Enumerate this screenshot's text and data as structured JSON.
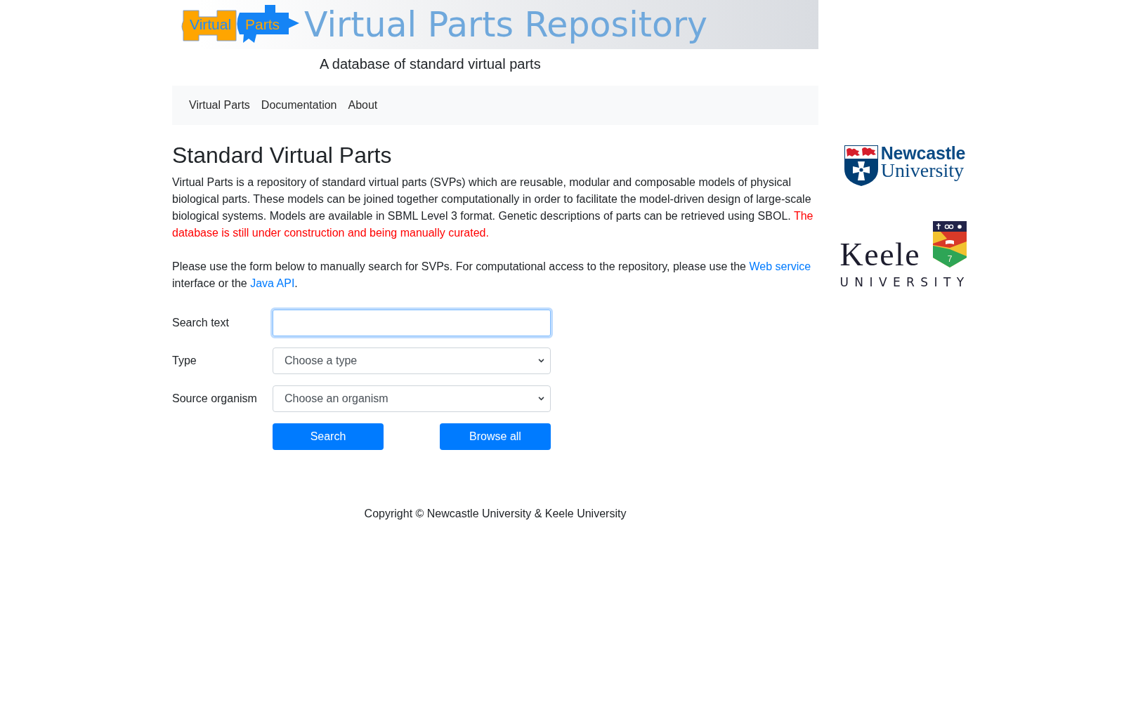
{
  "banner": {
    "logo_words": [
      "Virtual",
      "Parts"
    ],
    "title": "Virtual Parts Repository",
    "subtitle": "A database of standard virtual parts"
  },
  "nav": {
    "items": [
      {
        "label": "Virtual Parts"
      },
      {
        "label": "Documentation"
      },
      {
        "label": "About"
      }
    ]
  },
  "main": {
    "heading": "Standard Virtual Parts",
    "paragraphs": [
      [
        {
          "kind": "text",
          "text": "Virtual Parts is a repository of standard virtual parts (SVPs) which are reusable, modular and composable models of physical biological parts. These models can be joined together computationally in order to facilitate the model-driven design of large-scale biological systems. Models are available in SBML Level 3 format. Genetic descriptions of parts can be retrieved using SBOL. "
        },
        {
          "kind": "warning",
          "text": "The database is still under construction and being manually curated."
        }
      ],
      [
        {
          "kind": "text",
          "text": "Please use the form below to manually search for SVPs. For computational access to the repository, please use the "
        },
        {
          "kind": "link",
          "text": "Web service"
        },
        {
          "kind": "text",
          "text": " interface or the "
        },
        {
          "kind": "link",
          "text": "Java API"
        },
        {
          "kind": "text",
          "text": "."
        }
      ]
    ]
  },
  "form": {
    "fields": [
      {
        "label": "Search text",
        "kind": "input",
        "focused": true
      },
      {
        "label": "Type",
        "kind": "select",
        "value": "Choose a type",
        "focused": false
      },
      {
        "label": "Source organism",
        "kind": "select",
        "value": "Choose an organism",
        "focused": false
      }
    ],
    "buttons": [
      "Search",
      "Browse all"
    ]
  },
  "footer": {
    "copyright": "Copyright © Newcastle University & Keele University"
  },
  "sponsors": [
    {
      "kind": "cross-shield",
      "words": [
        "Newcastle",
        "University"
      ]
    },
    {
      "kind": "banded-shield",
      "words": [
        "Keele",
        "UNIVERSITY"
      ],
      "crest_numeral": "7"
    }
  ]
}
